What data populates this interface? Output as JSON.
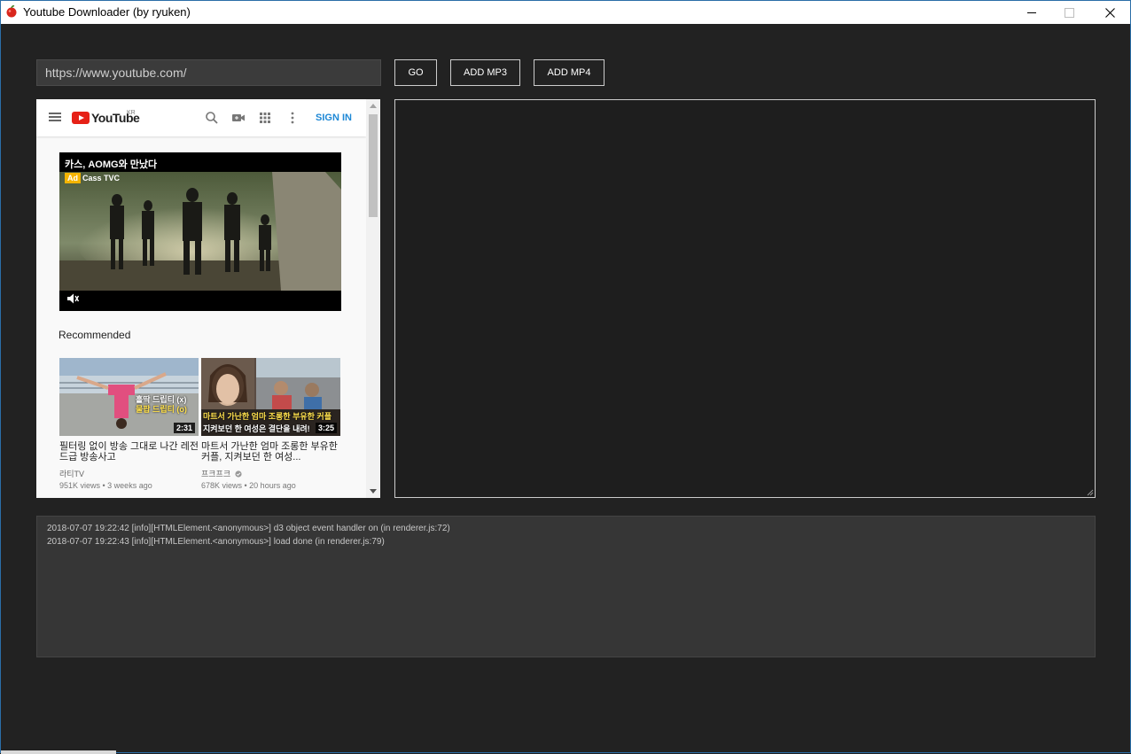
{
  "window": {
    "title": "Youtube Downloader (by ryuken)"
  },
  "toolbar": {
    "url_value": "https://www.youtube.com/",
    "go_label": "GO",
    "add_mp3_label": "ADD MP3",
    "add_mp4_label": "ADD MP4"
  },
  "youtube": {
    "logo_text": "YouTube",
    "region": "KR",
    "sign_in": "SIGN IN",
    "ad": {
      "title": "카스, AOMG와 만났다",
      "badge": "Ad",
      "channel": "Cass TVC"
    },
    "recommended_heading": "Recommended",
    "videos": [
      {
        "title": "필터링 없이 방송 그대로 나간 레전드급 방송사고",
        "channel": "라티TV",
        "meta": "951K views • 3 weeks ago",
        "duration": "2:31",
        "caption_line1": "홀딱 드립티 (x)",
        "caption_line2": "물팝 드립티 (o)"
      },
      {
        "title": "마트서 가난한 엄마 조롱한 부유한 커플, 지켜보던 한 여성...",
        "channel": "프크프크",
        "meta": "678K views • 20 hours ago",
        "duration": "3:25",
        "caption_line1": "마트서 가난한 엄마 조롱한 부유한 커플",
        "caption_line2": "지켜보던 한 여성은 결단을 내려!"
      }
    ]
  },
  "log": {
    "lines": [
      "2018-07-07 19:22:42 [info][HTMLElement.<anonymous>] d3 object event handler on (in renderer.js:72)",
      "2018-07-07 19:22:43 [info][HTMLElement.<anonymous>] load done (in renderer.js:79)"
    ]
  },
  "colors": {
    "background": "#222222",
    "youtube_red": "#e62117",
    "sign_in_blue": "#1e88d6",
    "ad_badge": "#f4b400"
  }
}
